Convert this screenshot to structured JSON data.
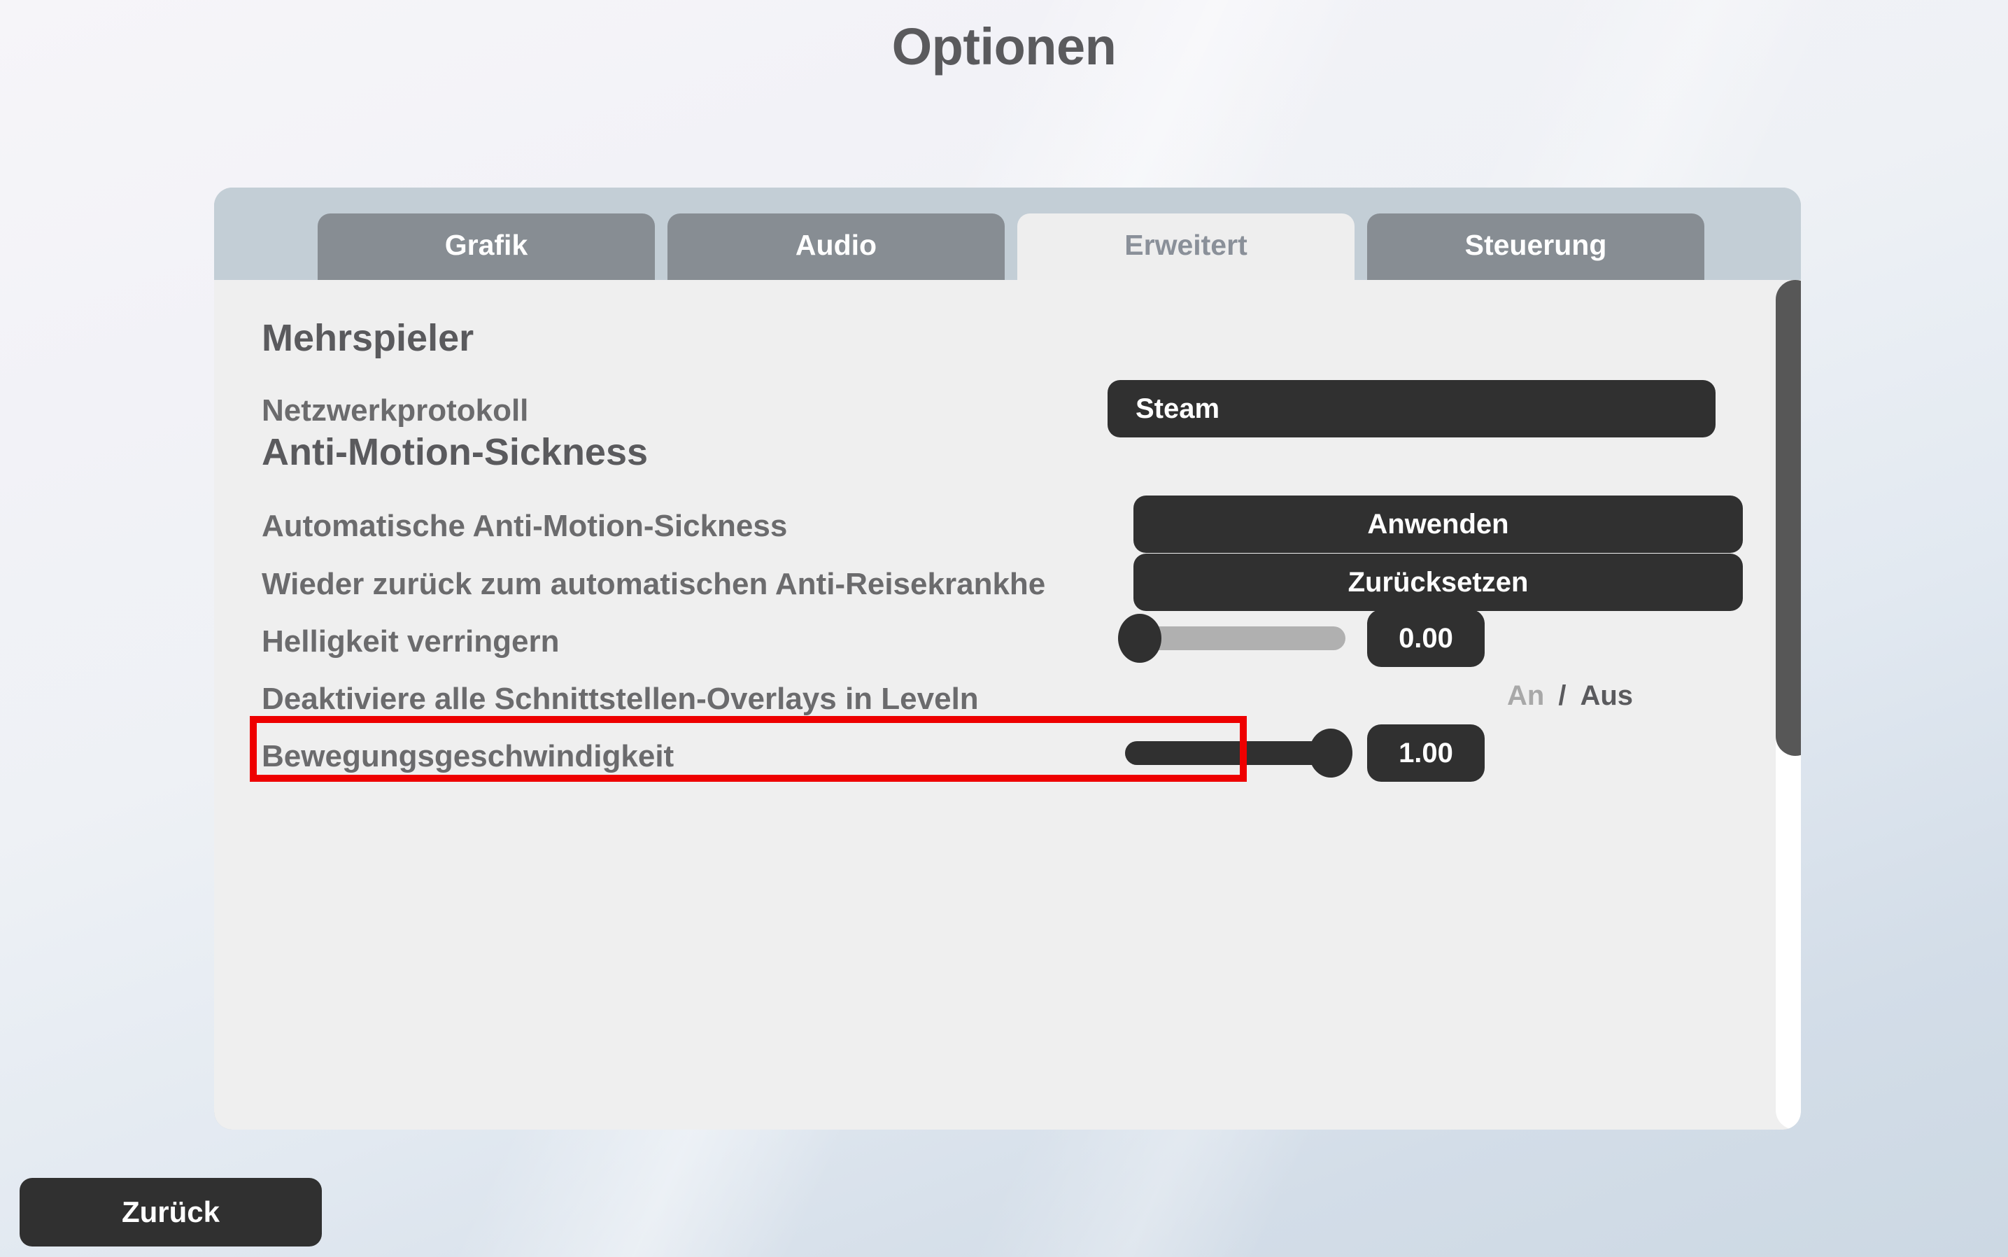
{
  "page": {
    "title": "Optionen"
  },
  "tabs": [
    {
      "label": "Grafik",
      "active": false
    },
    {
      "label": "Audio",
      "active": false
    },
    {
      "label": "Erweitert",
      "active": true
    },
    {
      "label": "Steuerung",
      "active": false
    }
  ],
  "sections": [
    {
      "heading": "Mehrspieler",
      "rows": [
        {
          "label": "Netzwerkprotokoll",
          "control": "dropdown-button",
          "value": "Steam"
        }
      ]
    },
    {
      "heading": "Anti-Motion-Sickness",
      "rows": [
        {
          "label": "Automatische Anti-Motion-Sickness",
          "control": "button",
          "value": "Anwenden"
        },
        {
          "label": "Wieder zurück zum automatischen Anti-Reisekrankhe",
          "control": "button",
          "value": "Zurücksetzen",
          "highlighted": true
        },
        {
          "label": "Helligkeit verringern",
          "control": "slider",
          "value": "0.00",
          "fill_percent": 0
        },
        {
          "label": "Deaktiviere alle Schnittstellen-Overlays in Leveln",
          "control": "toggle",
          "on_label": "An",
          "separator": "/",
          "off_label": "Aus",
          "selected": "Aus"
        },
        {
          "label": "Bewegungsgeschwindigkeit",
          "control": "slider",
          "value": "1.00",
          "fill_percent": 100
        }
      ]
    }
  ],
  "footer": {
    "back_label": "Zurück"
  },
  "colors": {
    "accent_dark": "#303030",
    "highlight": "#ee0000",
    "tab_bar": "#c3ced6",
    "tab_inactive": "#878d93",
    "panel_body": "#efefef"
  }
}
